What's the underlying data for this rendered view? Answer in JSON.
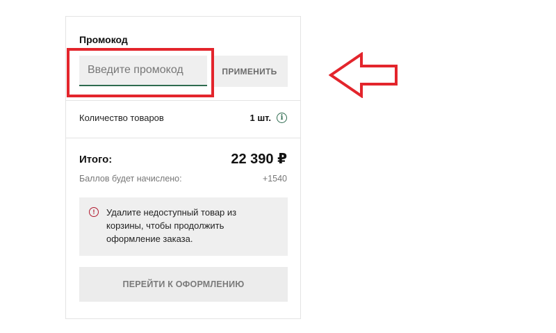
{
  "promo": {
    "title": "Промокод",
    "placeholder": "Введите промокод",
    "apply_label": "ПРИМЕНИТЬ"
  },
  "summary": {
    "count_label": "Количество товаров",
    "count_value": "1 шт.",
    "total_label": "Итого:",
    "total_value": "22 390 ₽",
    "points_label": "Баллов будет начислено:",
    "points_value": "+1540"
  },
  "alert": {
    "text": "Удалите недоступный товар из корзины, чтобы продолжить оформление заказа."
  },
  "checkout": {
    "label": "ПЕРЕЙТИ К ОФОРМЛЕНИЮ"
  },
  "colors": {
    "accent_green": "#2e6b4f",
    "error_red": "#b0182e",
    "annotation_red": "#e3252c"
  },
  "icons": {
    "info": "info-icon",
    "alert": "exclamation-icon",
    "annotation_arrow": "left-arrow-icon"
  }
}
